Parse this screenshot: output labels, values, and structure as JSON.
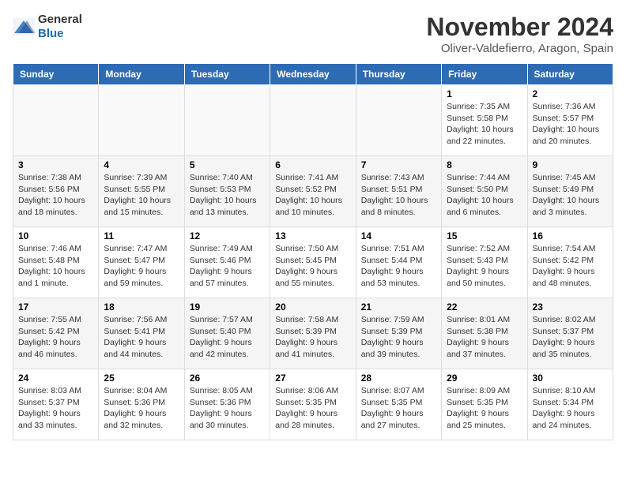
{
  "logo": {
    "text_general": "General",
    "text_blue": "Blue"
  },
  "header": {
    "month_title": "November 2024",
    "location": "Oliver-Valdefierro, Aragon, Spain"
  },
  "weekdays": [
    "Sunday",
    "Monday",
    "Tuesday",
    "Wednesday",
    "Thursday",
    "Friday",
    "Saturday"
  ],
  "weeks": [
    [
      {
        "day": "",
        "info": ""
      },
      {
        "day": "",
        "info": ""
      },
      {
        "day": "",
        "info": ""
      },
      {
        "day": "",
        "info": ""
      },
      {
        "day": "",
        "info": ""
      },
      {
        "day": "1",
        "info": "Sunrise: 7:35 AM\nSunset: 5:58 PM\nDaylight: 10 hours and 22 minutes."
      },
      {
        "day": "2",
        "info": "Sunrise: 7:36 AM\nSunset: 5:57 PM\nDaylight: 10 hours and 20 minutes."
      }
    ],
    [
      {
        "day": "3",
        "info": "Sunrise: 7:38 AM\nSunset: 5:56 PM\nDaylight: 10 hours and 18 minutes."
      },
      {
        "day": "4",
        "info": "Sunrise: 7:39 AM\nSunset: 5:55 PM\nDaylight: 10 hours and 15 minutes."
      },
      {
        "day": "5",
        "info": "Sunrise: 7:40 AM\nSunset: 5:53 PM\nDaylight: 10 hours and 13 minutes."
      },
      {
        "day": "6",
        "info": "Sunrise: 7:41 AM\nSunset: 5:52 PM\nDaylight: 10 hours and 10 minutes."
      },
      {
        "day": "7",
        "info": "Sunrise: 7:43 AM\nSunset: 5:51 PM\nDaylight: 10 hours and 8 minutes."
      },
      {
        "day": "8",
        "info": "Sunrise: 7:44 AM\nSunset: 5:50 PM\nDaylight: 10 hours and 6 minutes."
      },
      {
        "day": "9",
        "info": "Sunrise: 7:45 AM\nSunset: 5:49 PM\nDaylight: 10 hours and 3 minutes."
      }
    ],
    [
      {
        "day": "10",
        "info": "Sunrise: 7:46 AM\nSunset: 5:48 PM\nDaylight: 10 hours and 1 minute."
      },
      {
        "day": "11",
        "info": "Sunrise: 7:47 AM\nSunset: 5:47 PM\nDaylight: 9 hours and 59 minutes."
      },
      {
        "day": "12",
        "info": "Sunrise: 7:49 AM\nSunset: 5:46 PM\nDaylight: 9 hours and 57 minutes."
      },
      {
        "day": "13",
        "info": "Sunrise: 7:50 AM\nSunset: 5:45 PM\nDaylight: 9 hours and 55 minutes."
      },
      {
        "day": "14",
        "info": "Sunrise: 7:51 AM\nSunset: 5:44 PM\nDaylight: 9 hours and 53 minutes."
      },
      {
        "day": "15",
        "info": "Sunrise: 7:52 AM\nSunset: 5:43 PM\nDaylight: 9 hours and 50 minutes."
      },
      {
        "day": "16",
        "info": "Sunrise: 7:54 AM\nSunset: 5:42 PM\nDaylight: 9 hours and 48 minutes."
      }
    ],
    [
      {
        "day": "17",
        "info": "Sunrise: 7:55 AM\nSunset: 5:42 PM\nDaylight: 9 hours and 46 minutes."
      },
      {
        "day": "18",
        "info": "Sunrise: 7:56 AM\nSunset: 5:41 PM\nDaylight: 9 hours and 44 minutes."
      },
      {
        "day": "19",
        "info": "Sunrise: 7:57 AM\nSunset: 5:40 PM\nDaylight: 9 hours and 42 minutes."
      },
      {
        "day": "20",
        "info": "Sunrise: 7:58 AM\nSunset: 5:39 PM\nDaylight: 9 hours and 41 minutes."
      },
      {
        "day": "21",
        "info": "Sunrise: 7:59 AM\nSunset: 5:39 PM\nDaylight: 9 hours and 39 minutes."
      },
      {
        "day": "22",
        "info": "Sunrise: 8:01 AM\nSunset: 5:38 PM\nDaylight: 9 hours and 37 minutes."
      },
      {
        "day": "23",
        "info": "Sunrise: 8:02 AM\nSunset: 5:37 PM\nDaylight: 9 hours and 35 minutes."
      }
    ],
    [
      {
        "day": "24",
        "info": "Sunrise: 8:03 AM\nSunset: 5:37 PM\nDaylight: 9 hours and 33 minutes."
      },
      {
        "day": "25",
        "info": "Sunrise: 8:04 AM\nSunset: 5:36 PM\nDaylight: 9 hours and 32 minutes."
      },
      {
        "day": "26",
        "info": "Sunrise: 8:05 AM\nSunset: 5:36 PM\nDaylight: 9 hours and 30 minutes."
      },
      {
        "day": "27",
        "info": "Sunrise: 8:06 AM\nSunset: 5:35 PM\nDaylight: 9 hours and 28 minutes."
      },
      {
        "day": "28",
        "info": "Sunrise: 8:07 AM\nSunset: 5:35 PM\nDaylight: 9 hours and 27 minutes."
      },
      {
        "day": "29",
        "info": "Sunrise: 8:09 AM\nSunset: 5:35 PM\nDaylight: 9 hours and 25 minutes."
      },
      {
        "day": "30",
        "info": "Sunrise: 8:10 AM\nSunset: 5:34 PM\nDaylight: 9 hours and 24 minutes."
      }
    ]
  ]
}
